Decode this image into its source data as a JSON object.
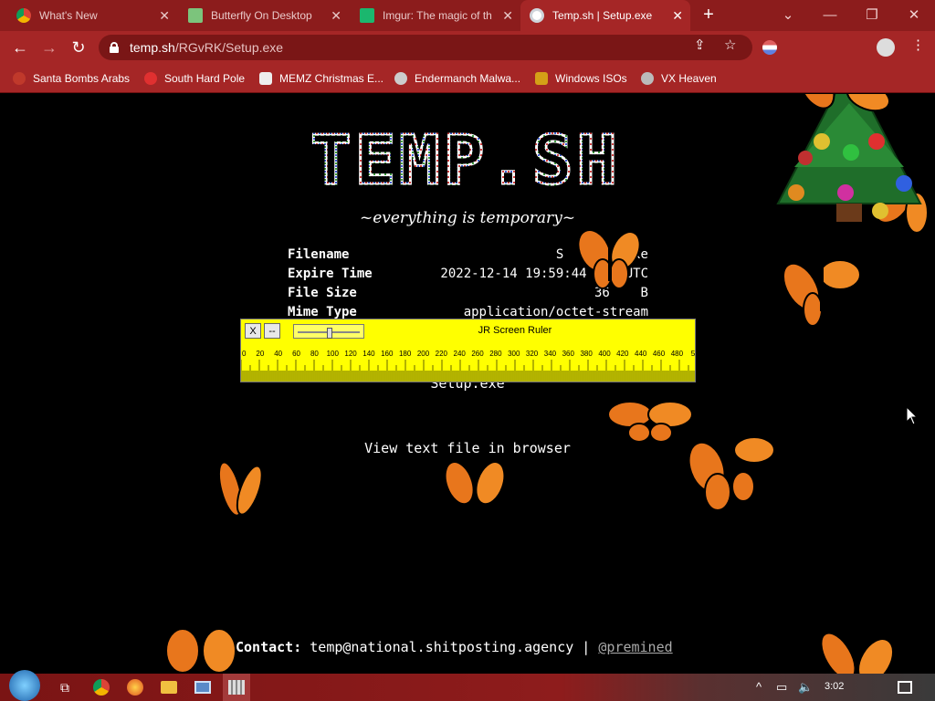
{
  "tabs": [
    {
      "title": "What's New",
      "icon": "chrome-icon"
    },
    {
      "title": "Butterfly On Desktop",
      "icon": "page-icon"
    },
    {
      "title": "Imgur: The magic of th",
      "icon": "imgur-icon"
    },
    {
      "title": "Temp.sh | Setup.exe",
      "icon": "globe-icon",
      "active": true
    }
  ],
  "address": {
    "domain": "temp.sh",
    "path": "/RGvRK/Setup.exe"
  },
  "bookmarks": [
    {
      "label": "Santa Bombs Arabs"
    },
    {
      "label": "South Hard Pole"
    },
    {
      "label": "MEMZ Christmas E..."
    },
    {
      "label": "Endermanch Malwa..."
    },
    {
      "label": "Windows ISOs"
    },
    {
      "label": "VX Heaven"
    }
  ],
  "page": {
    "logo_text": "TEMP.SH",
    "tagline": "~everything is temporary~",
    "info": [
      {
        "key": "Filename",
        "value": "S       .exe"
      },
      {
        "key": "Expire Time",
        "value": "2022-12-14 19:59:44 +   UTC"
      },
      {
        "key": "File Size",
        "value": "36    B"
      },
      {
        "key": "Mime Type",
        "value": "application/octet-stream"
      }
    ],
    "filename_link": "Setup.exe",
    "view_link": "View text file in browser",
    "contact_label": "Contact:",
    "contact_email": "temp@national.shitposting.agency",
    "contact_sep": "|",
    "contact_handle": "@premined"
  },
  "ruler": {
    "title": "JR Screen Ruler",
    "close_label": "X",
    "min_label": "--",
    "ticks": [
      "0",
      "20",
      "40",
      "60",
      "80",
      "100",
      "120",
      "140",
      "160",
      "180",
      "200",
      "220",
      "240",
      "260",
      "280",
      "300",
      "320",
      "340",
      "360",
      "380",
      "400",
      "420",
      "440",
      "460",
      "480",
      "50"
    ]
  },
  "taskbar": {
    "time": "3:02",
    "icons": [
      "start-orb-icon",
      "task-view-icon",
      "chrome-icon",
      "firefox-icon",
      "file-explorer-icon",
      "window-icon",
      "ruler-app-icon"
    ]
  },
  "colors": {
    "chrome_bg": "#a52626",
    "tab_bg": "#8c1c1c",
    "ruler_bg": "#ffff00",
    "page_bg": "#000000"
  }
}
